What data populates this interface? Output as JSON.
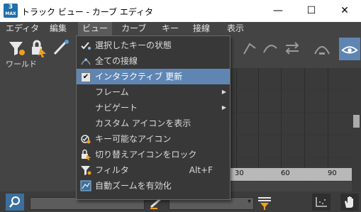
{
  "window": {
    "title": "トラック ビュー - カーブ エディタ",
    "app_icon_text_top": "3",
    "app_icon_text_bottom": "MAX",
    "minimize": "—",
    "maximize": "☐",
    "close": "✕"
  },
  "menubar": {
    "items": [
      "エディタ",
      "編集",
      "ビュー",
      "カーブ",
      "キー",
      "接線",
      "表示"
    ],
    "active_index": 2
  },
  "toolbar": {
    "label": "ワールド"
  },
  "view_menu": {
    "items": [
      {
        "label": "選択したキーの状態",
        "icon": "select-keys-icon"
      },
      {
        "label": "全ての接線",
        "icon": "all-tangents-icon"
      },
      {
        "label": "インタラクティブ 更新",
        "checked": true,
        "highlighted": true
      },
      {
        "label": "フレーム",
        "submenu": true
      },
      {
        "label": "ナビゲート",
        "submenu": true
      },
      {
        "label": "カスタム アイコンを表示"
      },
      {
        "label": "キー可能なアイコン",
        "icon": "keyable-icon"
      },
      {
        "label": "切り替えアイコンをロック",
        "icon": "lock-toggle-icon"
      },
      {
        "label": "フィルタ",
        "shortcut": "Alt+F",
        "icon": "filter-icon"
      },
      {
        "label": "自動ズームを有効化",
        "icon": "auto-zoom-icon"
      }
    ]
  },
  "ruler": {
    "ticks": [
      "30",
      "60",
      "90"
    ]
  },
  "colors": {
    "highlight": "#5f86b3",
    "menu_bg": "#383838",
    "panel_bg": "#444444"
  }
}
